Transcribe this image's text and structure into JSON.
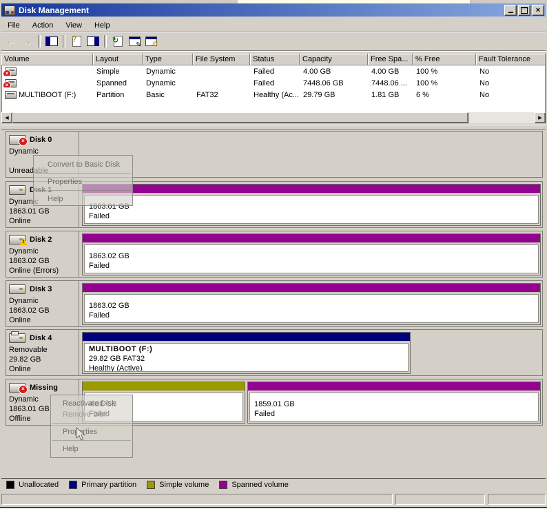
{
  "window": {
    "title": "Disk Management"
  },
  "menu_bar": {
    "items": [
      "File",
      "Action",
      "View",
      "Help"
    ]
  },
  "toolbar": {
    "icons": [
      "back-icon",
      "forward-icon",
      "show-console-tree-icon",
      "context-help-icon",
      "show-detail-pane-icon",
      "refresh-icon",
      "properties-window-icon",
      "manage-window-icon"
    ]
  },
  "volume_table": {
    "columns": [
      "Volume",
      "Layout",
      "Type",
      "File System",
      "Status",
      "Capacity",
      "Free Spa...",
      "% Free",
      "Fault Tolerance"
    ],
    "rows": [
      {
        "icon": "failed-volume-icon",
        "volume": "",
        "layout": "Simple",
        "type": "Dynamic",
        "file_system": "",
        "status": "Failed",
        "capacity": "4.00 GB",
        "free_space": "4.00 GB",
        "pct_free": "100 %",
        "fault_tolerance": "No"
      },
      {
        "icon": "failed-volume-icon",
        "volume": "",
        "layout": "Spanned",
        "type": "Dynamic",
        "file_system": "",
        "status": "Failed",
        "capacity": "7448.06 GB",
        "free_space": "7448.06 ...",
        "pct_free": "100 %",
        "fault_tolerance": "No"
      },
      {
        "icon": "healthy-volume-icon",
        "volume": "MULTIBOOT (F:)",
        "layout": "Partition",
        "type": "Basic",
        "file_system": "FAT32",
        "status": "Healthy (Ac...",
        "capacity": "29.79 GB",
        "free_space": "1.81 GB",
        "pct_free": "6 %",
        "fault_tolerance": "No"
      }
    ]
  },
  "disks": [
    {
      "name": "Disk 0",
      "icon": "disk-error-icon",
      "line1": "Dynamic",
      "line2": "",
      "line3": "Unreadable"
    },
    {
      "name": "Disk 1",
      "icon": "disk-icon",
      "line1": "Dynamic",
      "line2": "1863.01 GB",
      "line3": "Online",
      "volume": {
        "size": "1863.01 GB",
        "status": "Failed",
        "band": "spanned"
      }
    },
    {
      "name": "Disk 2",
      "icon": "disk-warning-icon",
      "line1": "Dynamic",
      "line2": "1863.02 GB",
      "line3": "Online (Errors)",
      "volume": {
        "size": "1863.02 GB",
        "status": "Failed",
        "band": "spanned"
      }
    },
    {
      "name": "Disk 3",
      "icon": "disk-icon",
      "line1": "Dynamic",
      "line2": "1863.02 GB",
      "line3": "Online",
      "volume": {
        "size": "1863.02 GB",
        "status": "Failed",
        "band": "spanned"
      }
    },
    {
      "name": "Disk 4",
      "icon": "disk-removable-icon",
      "line1": "Removable",
      "line2": "29.82 GB",
      "line3": "Online",
      "volume": {
        "label": "MULTIBOOT  (F:)",
        "size": "29.82 GB FAT32",
        "status": "Healthy (Active)",
        "band": "primary"
      }
    },
    {
      "name": "Missing",
      "icon": "disk-error-icon",
      "line1": "Dynamic",
      "line2": "1863.01 GB",
      "line3": "Offline",
      "volume1": {
        "size": "4.00 GB",
        "status": "Failed",
        "band": "simple"
      },
      "volume2": {
        "size": "1859.01 GB",
        "status": "Failed",
        "band": "spanned"
      }
    }
  ],
  "context_menus": {
    "disk0": {
      "items": [
        {
          "label": "Convert to Basic Disk"
        },
        {
          "label": "Properties"
        },
        {
          "label": "Help"
        }
      ]
    },
    "missing": {
      "items": [
        {
          "label": "Reactivate Disk"
        },
        {
          "label": "Remove Disk",
          "disabled": true
        },
        {
          "label": "Properties"
        },
        {
          "label": "Help"
        }
      ]
    }
  },
  "legend": {
    "items": [
      {
        "label": "Unallocated",
        "color": "#000000"
      },
      {
        "label": "Primary partition",
        "color": "#000080"
      },
      {
        "label": "Simple volume",
        "color": "#9B9B00"
      },
      {
        "label": "Spanned volume",
        "color": "#94038F"
      }
    ]
  },
  "colors": {
    "unallocated": "#000000",
    "primary_partition": "#000080",
    "simple_volume": "#9B9B00",
    "spanned_volume": "#94038F",
    "title_gradient_start": "#16379C",
    "title_gradient_end": "#89A9DF"
  }
}
